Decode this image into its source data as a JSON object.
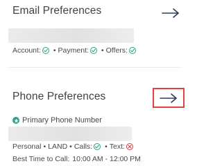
{
  "email": {
    "title": "Email Preferences",
    "status": [
      {
        "label": "Account:",
        "state": "ok"
      },
      {
        "label": "Payment:",
        "state": "ok"
      },
      {
        "label": "Offers:",
        "state": "ok"
      }
    ],
    "separator": "•"
  },
  "phone": {
    "title": "Phone Preferences",
    "primary_label": "Primary Phone Number",
    "line_type": "Personal",
    "carrier_type": "LAND",
    "calls_label": "Calls:",
    "text_label": "Text:",
    "separator": "•",
    "best_time_label": "Best Time to Call:",
    "best_time_value": "10:00 AM - 12:00 PM"
  },
  "colors": {
    "ok": "#2aa58a",
    "no": "#d63c3c",
    "highlight": "#e33f3f",
    "arrow": "#2e3a5c"
  },
  "icons": {
    "arrow": "arrow-right-icon",
    "ok": "check-circle-icon",
    "no": "x-circle-icon",
    "star": "star-badge-icon"
  }
}
